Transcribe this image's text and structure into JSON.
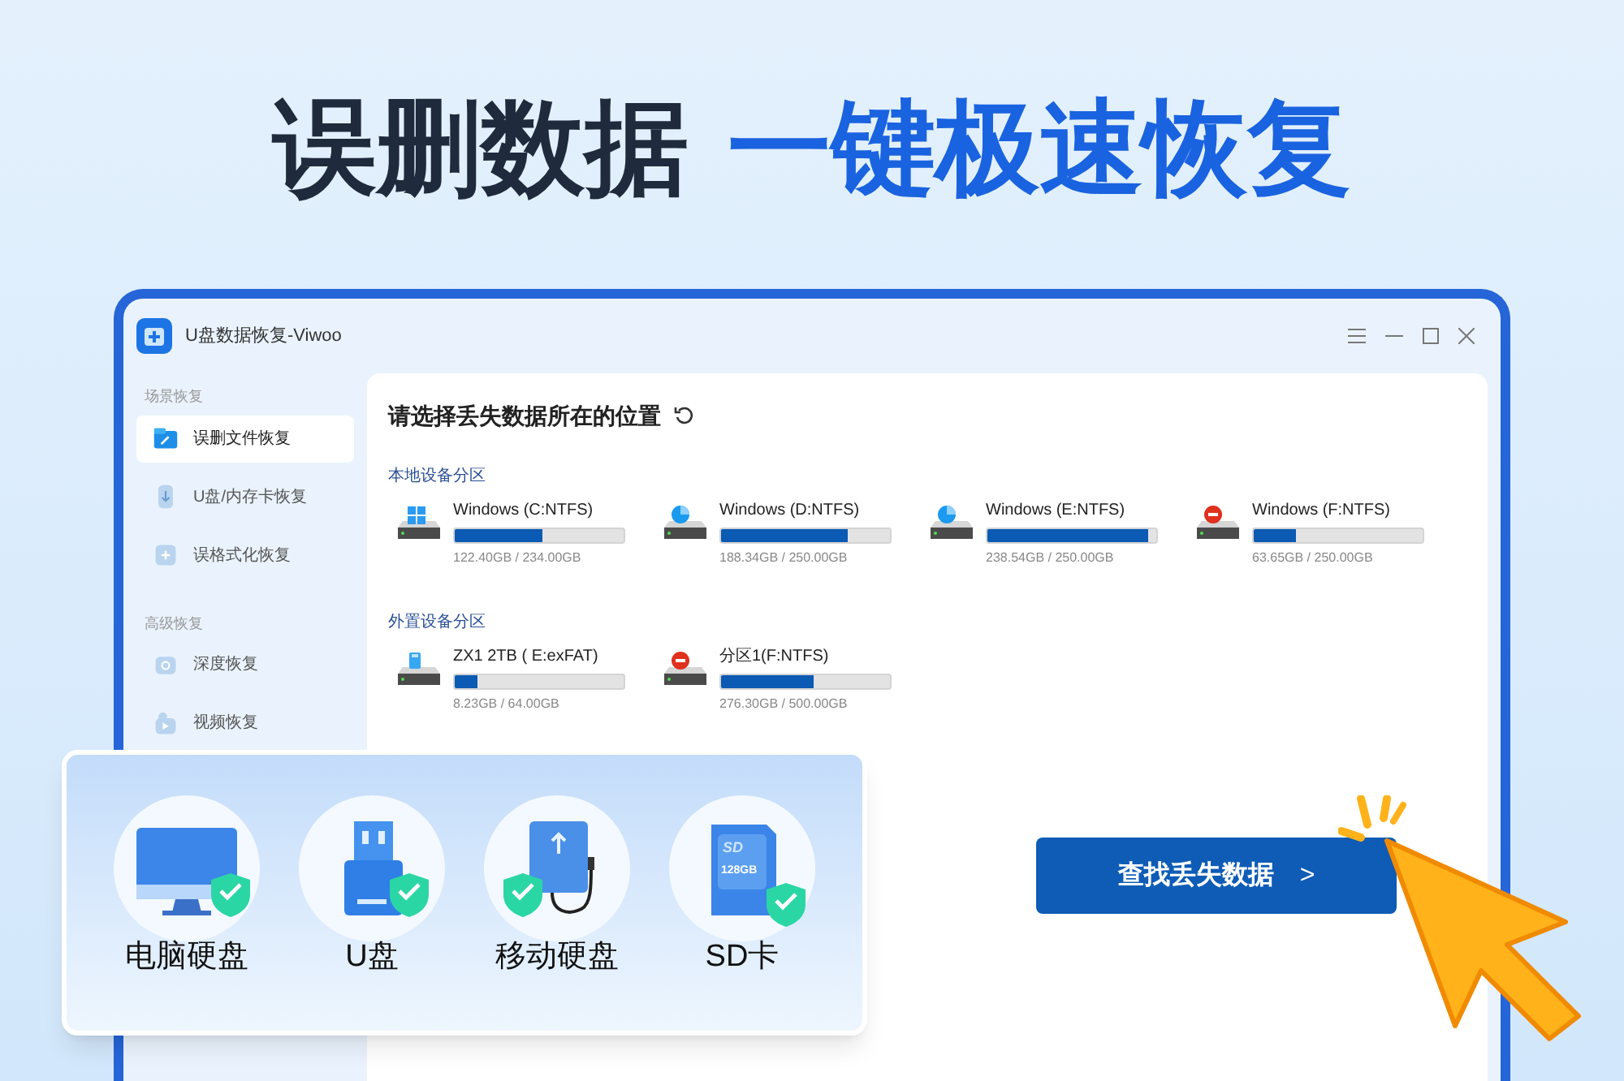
{
  "headline": {
    "dark": "误删数据",
    "accent": "一键极速恢复"
  },
  "window": {
    "title": "U盘数据恢复-Viwoo"
  },
  "sidebar": {
    "sections": [
      {
        "label": "场景恢复",
        "items": [
          {
            "label": "误删文件恢复",
            "kind": "folder",
            "selected": true
          },
          {
            "label": "U盘/内存卡恢复",
            "kind": "usb",
            "selected": false
          },
          {
            "label": "误格式化恢复",
            "kind": "format",
            "selected": false
          }
        ]
      },
      {
        "label": "高级恢复",
        "items": [
          {
            "label": "深度恢复",
            "kind": "deep",
            "selected": false
          },
          {
            "label": "视频恢复",
            "kind": "video",
            "selected": false
          }
        ]
      }
    ]
  },
  "content": {
    "title": "请选择丢失数据所在的位置",
    "groups": [
      {
        "label": "本地设备分区",
        "drives": [
          {
            "name": "Windows (C:NTFS)",
            "kind": "windows",
            "level": 0.52,
            "size": "122.40GB / 234.00GB"
          },
          {
            "name": "Windows (D:NTFS)",
            "kind": "pie",
            "level": 0.75,
            "size": "188.34GB / 250.00GB"
          },
          {
            "name": "Windows (E:NTFS)",
            "kind": "pie",
            "level": 0.95,
            "size": "238.54GB / 250.00GB"
          },
          {
            "name": "Windows (F:NTFS)",
            "kind": "blocked",
            "level": 0.25,
            "size": "63.65GB / 250.00GB"
          }
        ]
      },
      {
        "label": "外置设备分区",
        "drives": [
          {
            "name": "ZX1 2TB ( E:exFAT)",
            "kind": "usb",
            "level": 0.13,
            "size": "8.23GB / 64.00GB"
          },
          {
            "name": "分区1(F:NTFS)",
            "kind": "blocked",
            "level": 0.55,
            "size": "276.30GB / 500.00GB"
          }
        ]
      }
    ],
    "button": "查找丢失数据",
    "button_arrow": ">"
  },
  "features": [
    {
      "label": "电脑硬盘",
      "kind": "monitor"
    },
    {
      "label": "U盘",
      "kind": "usb"
    },
    {
      "label": "移动硬盘",
      "kind": "external"
    },
    {
      "label": "SD卡",
      "kind": "sd",
      "card_label": "SD",
      "card_capacity": "128GB"
    }
  ]
}
